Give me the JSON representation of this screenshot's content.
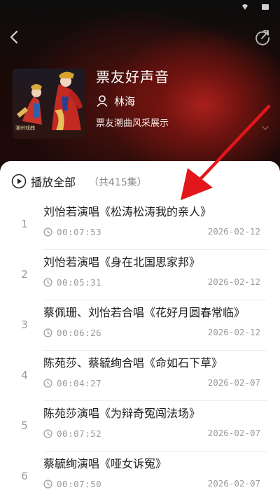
{
  "status_bar": {
    "icons": [
      "wifi-icon",
      "battery-icon"
    ]
  },
  "header": {
    "back_icon": "chevron-left-icon",
    "share_icon": "share-refresh-icon"
  },
  "album": {
    "title": "票友好声音",
    "author": "林海",
    "description": "票友潮曲风采展示",
    "cover_watermark": "潮州戏曲"
  },
  "playlist": {
    "play_all_label": "播放全部",
    "episode_count": "（共415集）",
    "tracks": [
      {
        "index": "1",
        "title": "刘怡若演唱《松涛松涛我的亲人》",
        "duration": "00:07:53",
        "date": "2026-02-12"
      },
      {
        "index": "2",
        "title": "刘怡若演唱《身在北国思家邦》",
        "duration": "00:05:31",
        "date": "2026-02-12"
      },
      {
        "index": "3",
        "title": "蔡佩珊、刘怡若合唱《花好月圆春常临》",
        "duration": "00:06:26",
        "date": "2026-02-12"
      },
      {
        "index": "4",
        "title": "陈苑莎、蔡毓绚合唱《命如石下草》",
        "duration": "00:04:27",
        "date": "2026-02-07"
      },
      {
        "index": "5",
        "title": "陈苑莎演唱《为辩奇冤闯法场》",
        "duration": "00:07:52",
        "date": "2026-02-07"
      },
      {
        "index": "6",
        "title": "蔡毓绚演唱《哑女诉冤》",
        "duration": "00:07:50",
        "date": "2026-02-07"
      }
    ]
  },
  "colors": {
    "annotation_arrow": "#e3161b",
    "hero_red": "#a8201c",
    "text_secondary": "#9a9a9a"
  }
}
